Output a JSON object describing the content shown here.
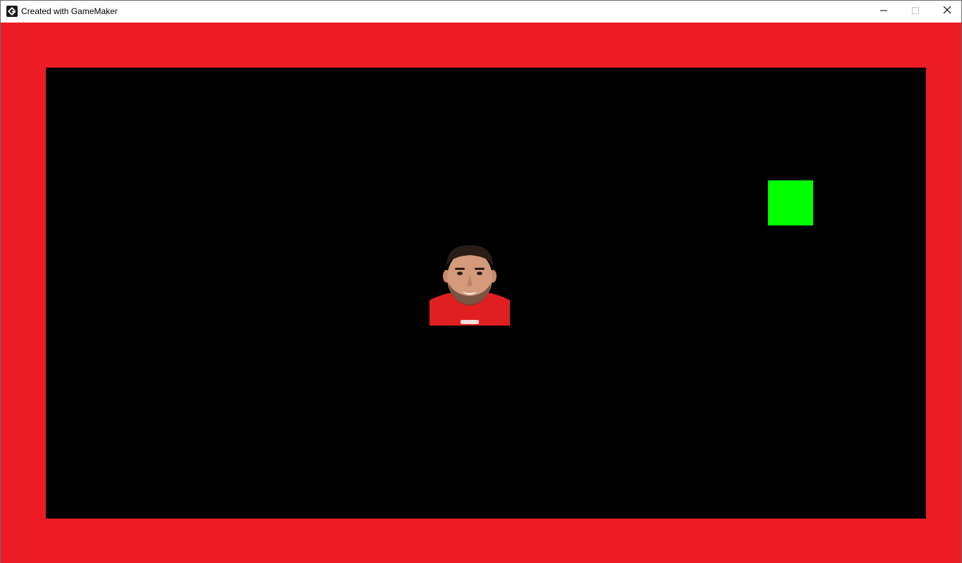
{
  "window": {
    "title": "Created with GameMaker",
    "icon": "gamemaker-logo-icon",
    "controls": [
      "minimize-icon",
      "maximize-icon",
      "close-icon"
    ]
  },
  "game": {
    "background_color": "#ed1c24",
    "room_color": "#000000",
    "objects": [
      {
        "name": "green-block",
        "color": "#00ff00"
      },
      {
        "name": "player-sprite",
        "description_icon": "person-face-sprite",
        "shirt_color": "#e02020"
      }
    ]
  }
}
